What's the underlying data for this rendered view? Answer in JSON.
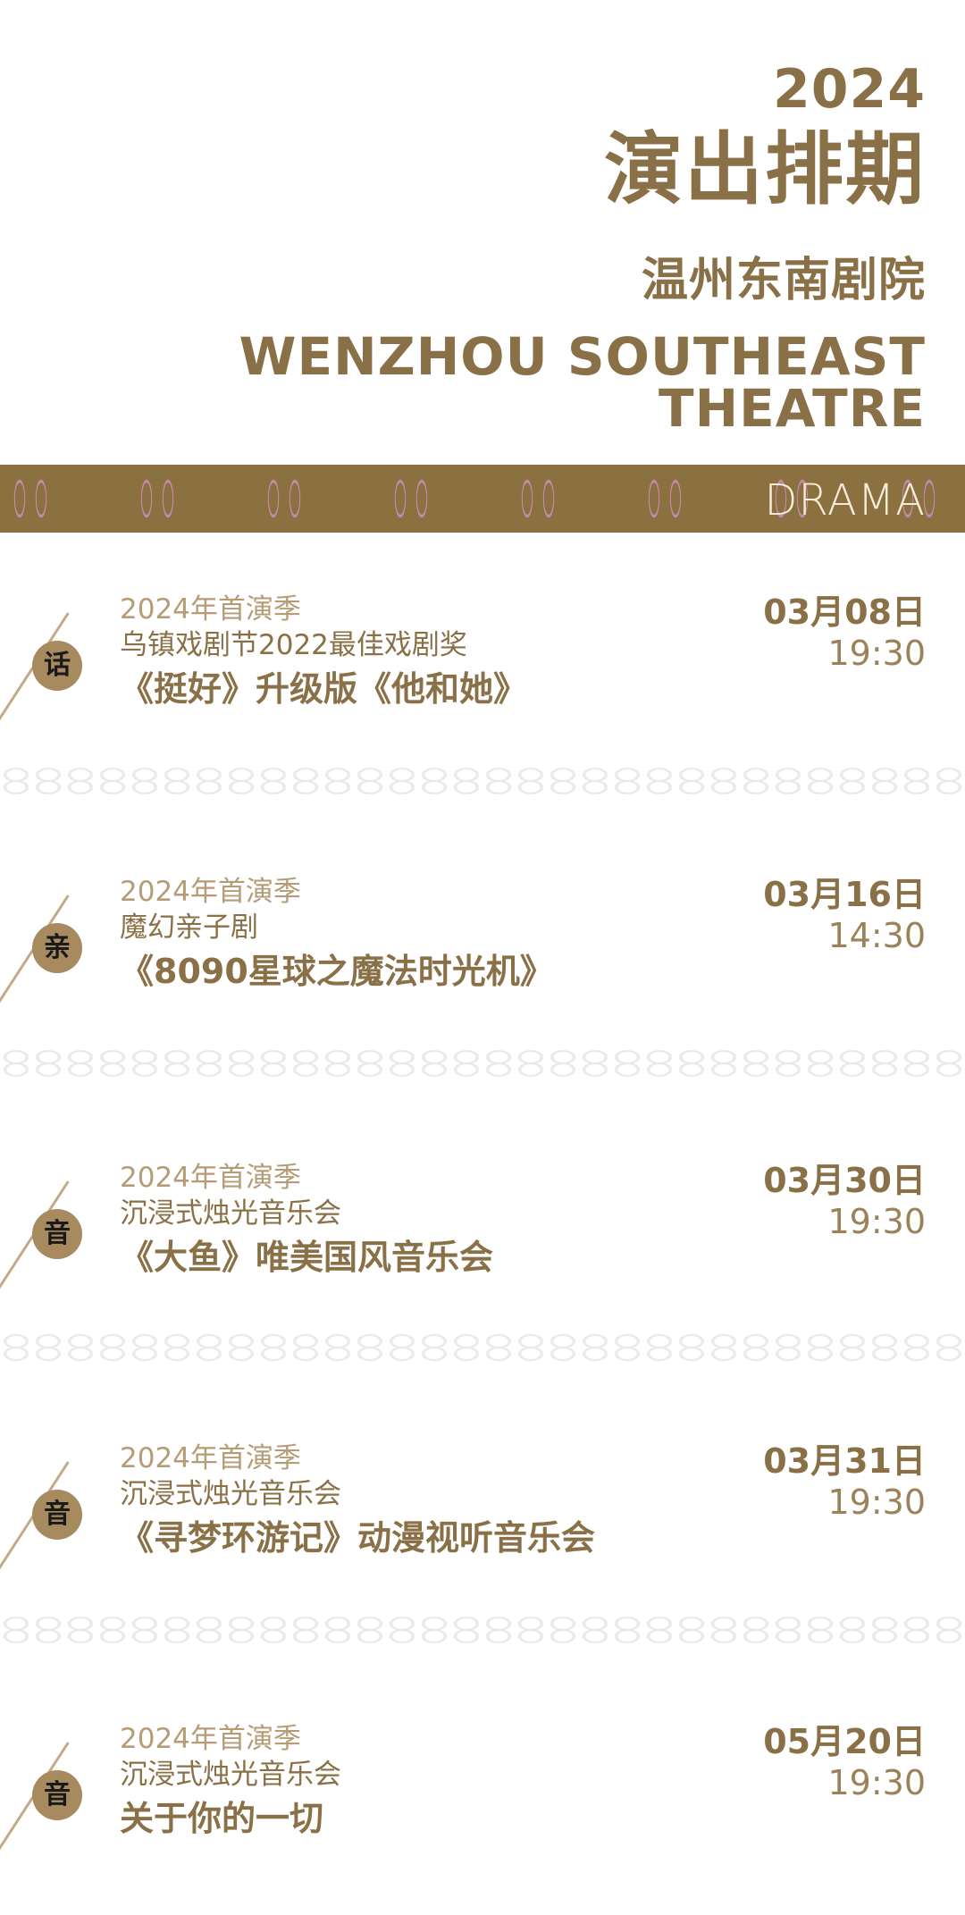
{
  "header": {
    "year": "2024",
    "title": "演出排期",
    "theatre_cn": "温州东南剧院",
    "theatre_en": "WENZHOU SOUTHEAST THEATRE"
  },
  "banner": {
    "label": "DRAMA"
  },
  "colors": {
    "accent": "#8a7047",
    "banner_bg": "#8b7040",
    "banner_pattern": "#c989b7",
    "badge_bg": "#a88a5f"
  },
  "events": [
    {
      "badge": "话",
      "season": "2024年首演季",
      "subtitle": "乌镇戏剧节2022最佳戏剧奖",
      "title": "《挺好》升级版《他和她》",
      "date": "03月08日",
      "time": "19:30"
    },
    {
      "badge": "亲",
      "season": "2024年首演季",
      "subtitle": "魔幻亲子剧",
      "title": "《8090星球之魔法时光机》",
      "date": "03月16日",
      "time": "14:30"
    },
    {
      "badge": "音",
      "season": "2024年首演季",
      "subtitle": "沉浸式烛光音乐会",
      "title": "《大鱼》唯美国风音乐会",
      "date": "03月30日",
      "time": "19:30"
    },
    {
      "badge": "音",
      "season": "2024年首演季",
      "subtitle": "沉浸式烛光音乐会",
      "title": "《寻梦环游记》动漫视听音乐会",
      "date": "03月31日",
      "time": "19:30"
    },
    {
      "badge": "音",
      "season": "2024年首演季",
      "subtitle": "沉浸式烛光音乐会",
      "title": "关于你的一切",
      "date": "05月20日",
      "time": "19:30"
    }
  ]
}
